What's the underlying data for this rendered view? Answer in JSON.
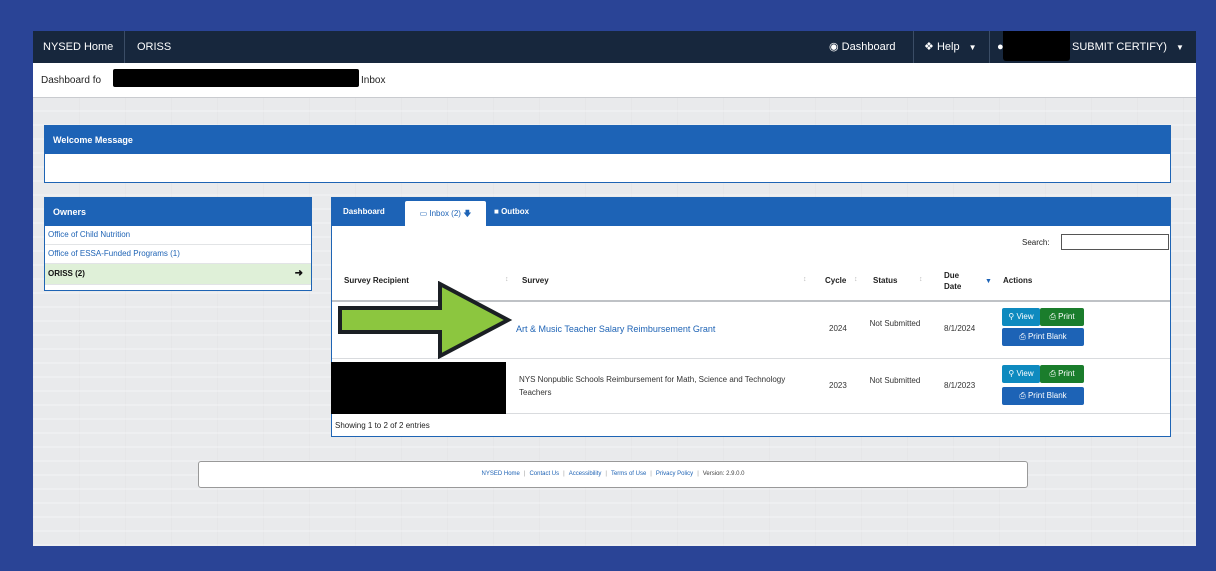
{
  "navbar": {
    "home": "NYSED Home",
    "app": "ORISS",
    "dashboard": "Dashboard",
    "help": "Help",
    "user_suffix": "SUBMIT CERTIFY)"
  },
  "breadcrumb": {
    "prefix": "Dashboard fo",
    "suffix": "Inbox"
  },
  "welcome": {
    "title": "Welcome Message"
  },
  "owners": {
    "title": "Owners",
    "items": [
      {
        "label": "Office of Child Nutrition"
      },
      {
        "label": "Office of ESSA-Funded Programs (1)"
      },
      {
        "label": "ORISS (2)"
      }
    ]
  },
  "tabs": [
    {
      "label": "Dashboard"
    },
    {
      "label": "Inbox (2)"
    },
    {
      "label": "Outbox"
    }
  ],
  "table": {
    "search_label": "Search:",
    "search_value": "",
    "headers": [
      "Survey Recipient",
      "Survey",
      "Cycle",
      "Status",
      "Due Date",
      "Actions"
    ],
    "rows": [
      {
        "survey": "Art & Music Teacher Salary Reimbursement Grant",
        "cycle": "2024",
        "status": "Not Submitted",
        "due": "8/1/2024"
      },
      {
        "survey": "NYS Nonpublic Schools Reimbursement for Math, Science and Technology Teachers",
        "cycle": "2023",
        "status": "Not Submitted",
        "due": "8/1/2023"
      }
    ],
    "info": "Showing 1 to 2 of 2 entries",
    "buttons": {
      "view": "View",
      "print": "Print",
      "print_blank": "Print Blank"
    }
  },
  "footer": {
    "links": [
      "NYSED Home",
      "Contact Us",
      "Accessibility",
      "Terms of Use",
      "Privacy Policy"
    ],
    "version": "Version: 2.9.0.0"
  },
  "colors": {
    "outer_border": "#2a4496",
    "navbar": "#17273d",
    "panel_header": "#1d63b6",
    "arrow": "#8cc63f",
    "view_button": "#0e8abf",
    "print_button": "#1a7d2c"
  },
  "icons": [
    "dashboard-icon",
    "info-icon",
    "user-icon",
    "inbox-icon",
    "outbox-icon",
    "search-icon",
    "print-icon",
    "arrow-right-icon",
    "sort-icon"
  ]
}
